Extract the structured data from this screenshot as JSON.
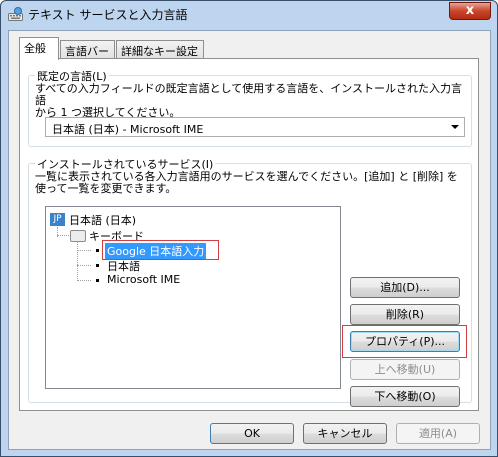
{
  "window": {
    "title": "テキスト サービスと入力言語",
    "close_label": "x",
    "title_icon": "keyboard-globe-icon"
  },
  "tabs": [
    {
      "label": "全般",
      "active": true
    },
    {
      "label": "言語バー",
      "active": false
    },
    {
      "label": "詳細なキー設定",
      "active": false
    }
  ],
  "default_language": {
    "group_title": "既定の言語(L)",
    "description": "すべての入力フィールドの既定言語として使用する言語を、インストールされた入力言語\nから 1 つ選択してください。",
    "selected": "日本語 (日本) - Microsoft IME"
  },
  "installed_services": {
    "group_title": "インストールされているサービス(I)",
    "description": "一覧に表示されている各入力言語用のサービスを選んでください。[追加] と [削除] を使って一覧を変更できます。",
    "tree": {
      "language": "日本語 (日本)",
      "language_badge": "JP",
      "category": "キーボード",
      "items": [
        {
          "label": "Google 日本語入力",
          "selected": true
        },
        {
          "label": "日本語",
          "selected": false
        },
        {
          "label": "Microsoft IME",
          "selected": false
        }
      ]
    },
    "buttons": {
      "add": "追加(D)...",
      "remove": "削除(R)",
      "properties": "プロパティ(P)...",
      "move_up": "上へ移動(U)",
      "move_down": "下へ移動(O)"
    }
  },
  "footer": {
    "ok": "OK",
    "cancel": "キャンセル",
    "apply": "適用(A)"
  },
  "colors": {
    "selection": "#3399ff",
    "highlight_box": "#d04040",
    "window_frame": "#bdd5ee"
  }
}
